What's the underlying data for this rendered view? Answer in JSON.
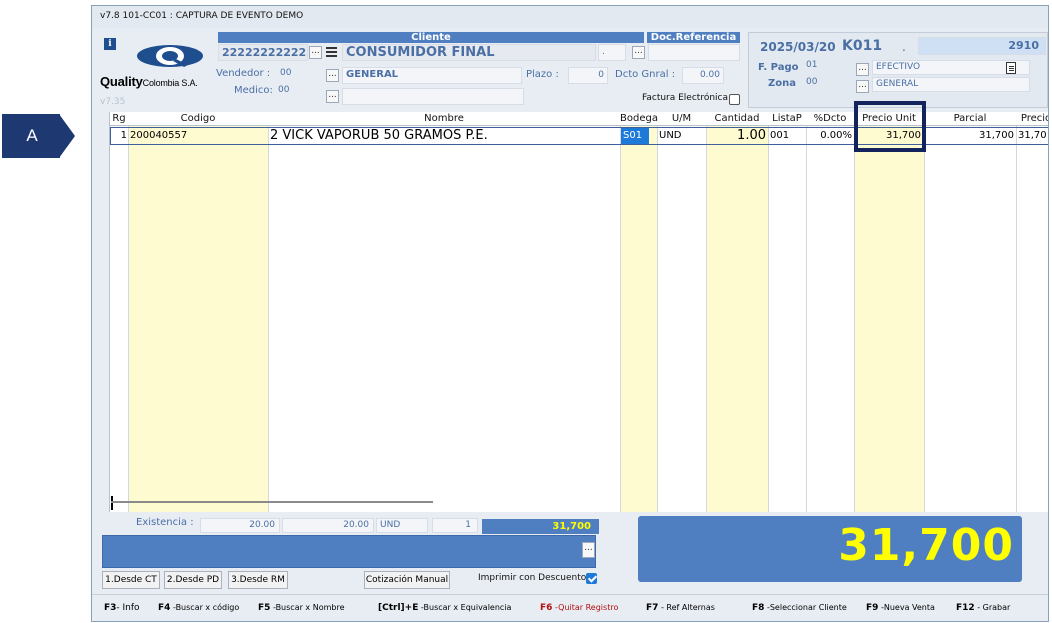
{
  "callout": {
    "label": "A"
  },
  "window": {
    "title": "v7.8 101-CC01 : CAPTURA DE EVENTO DEMO",
    "version_watermark": "v7.35"
  },
  "logo": {
    "brand": "Quality",
    "suffix": "Colombia S.A."
  },
  "header": {
    "cliente_band": "Cliente",
    "doc_ref_band": "Doc.Referencia",
    "client_id": "22222222222",
    "client_name": "CONSUMIDOR FINAL",
    "vendedor_label": "Vendedor :",
    "vendedor_code": "00",
    "vendedor_name": "GENERAL",
    "medico_label": "Medico:",
    "medico_code": "00",
    "plazo_label": "Plazo :",
    "plazo_value": "0",
    "dcto_label": "Dcto Gnral :",
    "dcto_value": "0.00",
    "factura_label": "Factura Electrónica",
    "factura_checked": false,
    "dot_value": "."
  },
  "right_panel": {
    "date": "2025/03/20",
    "code": "K011",
    "dot": ".",
    "number": "2910",
    "fpago_label": "F. Pago",
    "fpago_code": "01",
    "fpago_name": "EFECTIVO",
    "zona_label": "Zona",
    "zona_code": "00",
    "zona_name": "GENERAL"
  },
  "grid": {
    "columns": [
      "Rg",
      "Codigo",
      "Nombre",
      "Bodega",
      "U/M",
      "Cantidad",
      "ListaP",
      "%Dcto",
      "Precio Unit",
      "Parcial",
      "Precio"
    ],
    "rows": [
      {
        "rg": "1",
        "codigo": "200040557",
        "nombre": "2 VICK VAPORUB 50 GRAMOS P.E.",
        "bodega": "S01",
        "um": "UND",
        "cantidad": "1.00",
        "listap": "001",
        "dcto": "0.00%",
        "precio_unit": "31,700",
        "parcial": "31,700",
        "precio": "31,70"
      }
    ]
  },
  "footer": {
    "existencia_label": "Existencia :",
    "existencia_1": "20.00",
    "existencia_2": "20.00",
    "existencia_um": "UND",
    "existencia_count": "1",
    "precio_mini": "31,700",
    "total": "31,700",
    "btn_ct": "1.Desde CT",
    "btn_pd": "2.Desde PD",
    "btn_rm": "3.Desde RM",
    "btn_cotizacion": "Cotización Manual",
    "imprimir_label": "Imprimir con Descuento",
    "imprimir_checked": true,
    "dots": "..."
  },
  "fkeys": [
    {
      "key": "F3",
      "label": "- Info"
    },
    {
      "key": "F4",
      "label": " -Buscar x código"
    },
    {
      "key": "F5",
      "label": " -Buscar x Nombre"
    },
    {
      "key": "[Ctrl]+E",
      "label": " -Buscar x Equivalencia"
    },
    {
      "key": "F6",
      "label": " -Quitar Registro"
    },
    {
      "key": "F7",
      "label": " - Ref Alternas"
    },
    {
      "key": "F8",
      "label": " -Seleccionar Cliente"
    },
    {
      "key": "F9",
      "label": " -Nueva Venta"
    },
    {
      "key": "F12",
      "label": " - Grabar"
    }
  ],
  "colors": {
    "accent_blue": "#4f7fc0",
    "total_yellow": "#ffff00",
    "callout_navy": "#1e3872",
    "column_yellow": "#fffbd0"
  }
}
